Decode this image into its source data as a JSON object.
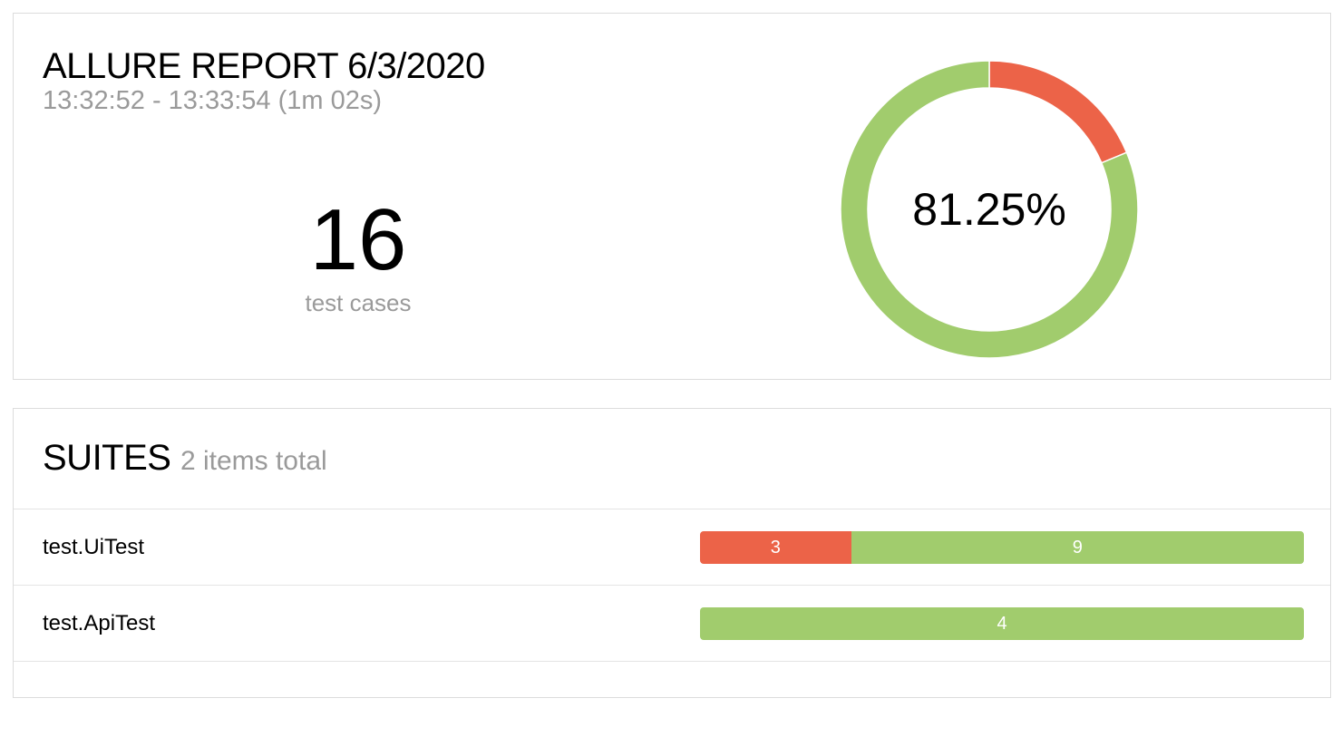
{
  "summary": {
    "title": "ALLURE REPORT 6/3/2020",
    "time_range": "13:32:52 - 13:33:54 (1m 02s)",
    "total_count": "16",
    "total_label": "test cases",
    "success_rate": "81.25%",
    "chart_segments": [
      {
        "status": "failed",
        "count": 3,
        "color": "#ec6348"
      },
      {
        "status": "passed",
        "count": 13,
        "color": "#a1cc6d"
      }
    ]
  },
  "suites": {
    "title": "SUITES",
    "count_label": "2 items total",
    "items": [
      {
        "name": "test.UiTest",
        "segments": [
          {
            "status": "failed",
            "value": 3,
            "label": "3",
            "color": "#ec6348"
          },
          {
            "status": "passed",
            "value": 9,
            "label": "9",
            "color": "#a1cc6d"
          }
        ]
      },
      {
        "name": "test.ApiTest",
        "segments": [
          {
            "status": "passed",
            "value": 4,
            "label": "4",
            "color": "#a1cc6d"
          }
        ]
      }
    ]
  }
}
